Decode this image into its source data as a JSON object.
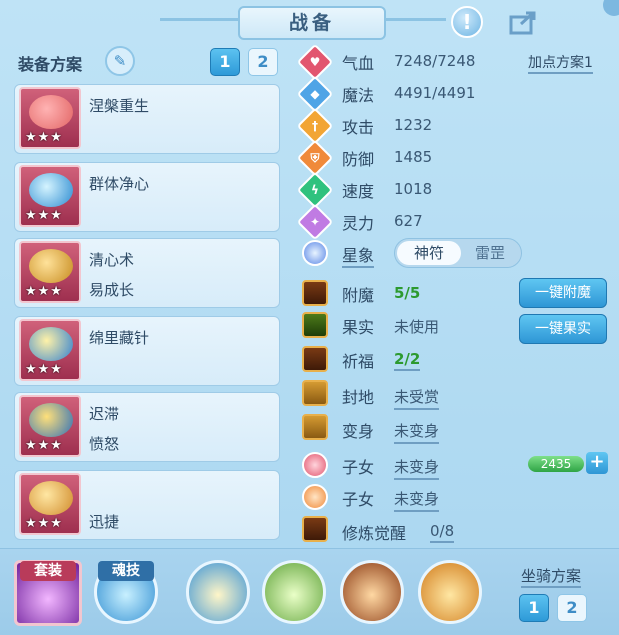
{
  "window": {
    "title": "战备"
  },
  "header": {
    "info_icon": "exclamation-icon",
    "share_icon": "share-icon"
  },
  "equip_panel": {
    "title": "装备方案",
    "plan_buttons": [
      "1",
      "2"
    ],
    "items": [
      {
        "names": [
          "涅槃重生"
        ],
        "stars": "★★★"
      },
      {
        "names": [
          "群体净心"
        ],
        "stars": "★★★"
      },
      {
        "names": [
          "清心术",
          "易成长"
        ],
        "stars": "★★★"
      },
      {
        "names": [
          "绵里藏针"
        ],
        "stars": "★★★"
      },
      {
        "names": [
          "迟滞",
          "愤怒"
        ],
        "stars": "★★★"
      },
      {
        "names": [
          "",
          "迅捷"
        ],
        "stars": "★★★"
      }
    ]
  },
  "stats": {
    "plan_link": "加点方案1",
    "rows": [
      {
        "label": "气血",
        "value": "7248/7248",
        "color": "#e2566f"
      },
      {
        "label": "魔法",
        "value": "4491/4491",
        "color": "#4fa4e6"
      },
      {
        "label": "攻击",
        "value": "1232",
        "color": "#f2a534"
      },
      {
        "label": "防御",
        "value": "1485",
        "color": "#f08a3a"
      },
      {
        "label": "速度",
        "value": "1018",
        "color": "#2fc27e"
      },
      {
        "label": "灵力",
        "value": "627",
        "color": "#c07be3"
      }
    ],
    "star_row": {
      "label": "星象",
      "toggle_on": "神符",
      "toggle_off": "雷罡"
    }
  },
  "extras": [
    {
      "label": "附魔",
      "value": "5/5"
    },
    {
      "label": "果实",
      "value": "未使用"
    },
    {
      "label": "祈福",
      "value": "2/2"
    },
    {
      "label": "封地",
      "value": "未受赏"
    },
    {
      "label": "变身",
      "value": "未变身"
    },
    {
      "label": "子女",
      "value": "未变身"
    },
    {
      "label": "子女",
      "value": "未变身"
    },
    {
      "label": "修炼觉醒",
      "value": "0/8"
    }
  ],
  "side_buttons": {
    "enchant": "一键附魔",
    "fruit": "一键果实"
  },
  "xp": {
    "value": "2435",
    "plus": "+"
  },
  "bottom": {
    "tags": {
      "set": "套装",
      "soul": "魂技"
    },
    "mount_title": "坐骑方案",
    "mount_buttons": [
      "1",
      "2"
    ]
  }
}
